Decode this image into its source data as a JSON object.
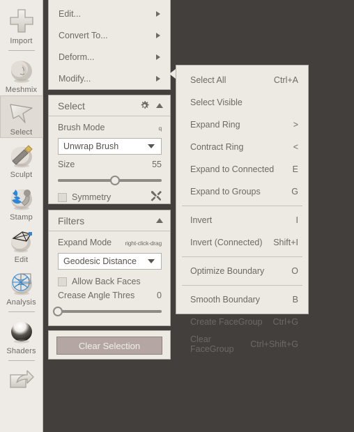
{
  "app": {
    "background_color": "#423f3c",
    "panel_color": "#edeae4",
    "text_color": "#6d6965"
  },
  "sidebar": {
    "items": [
      {
        "icon": "plus-import-icon",
        "label": "Import",
        "active": false
      },
      {
        "icon": "meshmix-head-icon",
        "label": "Meshmix",
        "active": false
      },
      {
        "icon": "cursor-arrow-icon",
        "label": "Select",
        "active": true
      },
      {
        "icon": "sculpt-brush-icon",
        "label": "Sculpt",
        "active": false
      },
      {
        "icon": "stamp-icon",
        "label": "Stamp",
        "active": false
      },
      {
        "icon": "edit-mesh-icon",
        "label": "Edit",
        "active": false
      },
      {
        "icon": "analysis-wire-icon",
        "label": "Analysis",
        "active": false
      },
      {
        "icon": "shaders-sphere-icon",
        "label": "Shaders",
        "active": false
      },
      {
        "icon": "export-share-icon",
        "label": "",
        "active": false
      }
    ]
  },
  "command_menu": {
    "items": [
      {
        "label": "Edit...",
        "submenu": true
      },
      {
        "label": "Convert To...",
        "submenu": true
      },
      {
        "label": "Deform...",
        "submenu": true
      },
      {
        "label": "Modify...",
        "submenu": true
      }
    ]
  },
  "select_panel": {
    "title": "Select",
    "gear_icon": "gear-icon",
    "collapse_icon": "chevron-up-icon",
    "brush_mode_label": "Brush Mode",
    "brush_mode_hint": "q",
    "brush_mode_value": "Unwrap Brush",
    "size_label": "Size",
    "size_value": "55",
    "size_percent": 55,
    "symmetry_label": "Symmetry",
    "symmetry_checked": false,
    "tools_icon": "wrench-screwdriver-icon"
  },
  "filters_panel": {
    "title": "Filters",
    "collapse_icon": "chevron-up-icon",
    "expand_mode_label": "Expand Mode",
    "expand_mode_hint": "right-click-drag",
    "expand_mode_value": "Geodesic Distance",
    "allow_back_faces_label": "Allow Back Faces",
    "allow_back_faces_checked": false,
    "crease_angle_label": "Crease Angle Thres",
    "crease_angle_value": "0",
    "crease_angle_percent": 0
  },
  "clear_panel": {
    "button_label": "Clear Selection"
  },
  "context_menu": {
    "groups": [
      [
        {
          "label": "Select All",
          "shortcut": "Ctrl+A"
        },
        {
          "label": "Select Visible",
          "shortcut": ""
        },
        {
          "label": "Expand Ring",
          "shortcut": ">"
        },
        {
          "label": "Contract Ring",
          "shortcut": "<"
        },
        {
          "label": "Expand to Connected",
          "shortcut": "E"
        },
        {
          "label": "Expand to Groups",
          "shortcut": "G"
        }
      ],
      [
        {
          "label": "Invert",
          "shortcut": "I"
        },
        {
          "label": "Invert (Connected)",
          "shortcut": "Shift+I"
        }
      ],
      [
        {
          "label": "Optimize Boundary",
          "shortcut": "O"
        }
      ],
      [
        {
          "label": "Smooth Boundary",
          "shortcut": "B"
        },
        {
          "label": "Create FaceGroup",
          "shortcut": "Ctrl+G"
        },
        {
          "label": "Clear FaceGroup",
          "shortcut": "Ctrl+Shift+G"
        }
      ]
    ]
  }
}
